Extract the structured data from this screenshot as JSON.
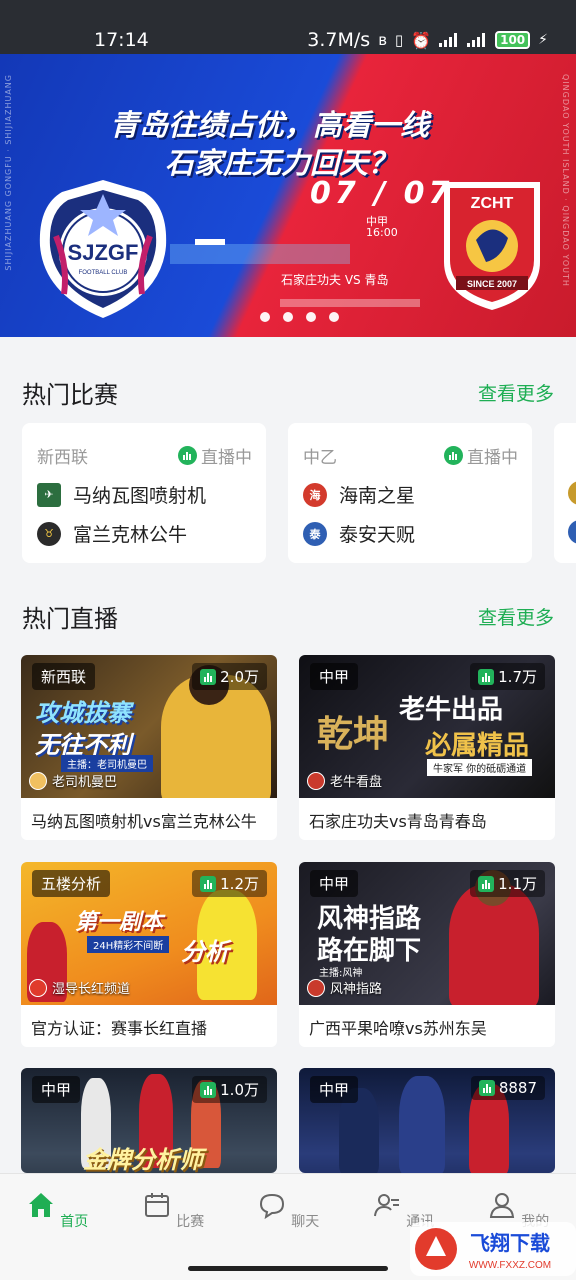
{
  "status_bar": {
    "time": "17:14",
    "speed": "3.7M/s",
    "battery": "100"
  },
  "banner": {
    "headline_line1": "青岛往绩占优，高看一线",
    "headline_line2": "石家庄无力回天？",
    "date": "07 / 07",
    "league": "中甲",
    "kickoff": "16:00",
    "match": "石家庄功夫 VS 青岛",
    "left_crest_text": "SJZGF",
    "left_crest_sub": "FOOTBALL CLUB",
    "right_crest_text": "ZCHT",
    "right_crest_sub": "SINCE 2007",
    "side_left": "SHIJIAZHUANG GONGFU · SHIJIAZHUANG",
    "side_right": "QINGDAO YOUTH ISLAND · QINGDAO YOUTH"
  },
  "hot_matches": {
    "title": "热门比赛",
    "more": "查看更多",
    "items": [
      {
        "league": "新西联",
        "status": "直播中",
        "home": "马纳瓦图喷射机",
        "away": "富兰克林公牛",
        "home_badge_color": "#2c6e3f",
        "away_badge_color": "#2b2b2b"
      },
      {
        "league": "中乙",
        "status": "直播中",
        "home": "海南之星",
        "away": "泰安天贶",
        "home_badge_color": "#d33a2c",
        "away_badge_color": "#2f5fb3"
      }
    ]
  },
  "hot_live": {
    "title": "热门直播",
    "more": "查看更多",
    "items": [
      {
        "league": "新西联",
        "viewers": "2.0万",
        "anchor": "老司机曼巴",
        "caption": "马纳瓦图喷射机vs富兰克林公牛",
        "thumb_text1": "攻城拔寨",
        "thumb_text2": "无往不利",
        "thumb_sub": "主播：老司机曼巴"
      },
      {
        "league": "中甲",
        "viewers": "1.7万",
        "anchor": "老牛看盘",
        "caption": "石家庄功夫vs青岛青春岛",
        "thumb_text1": "老牛出品",
        "thumb_text2": "必属精品",
        "thumb_sub": "牛家军 你的砥砺通道"
      },
      {
        "league": "五楼分析",
        "viewers": "1.2万",
        "anchor": "湿导长红频道",
        "caption": "官方认证：赛事长红直播",
        "thumb_text1": "第一剧本",
        "thumb_text2": "分析",
        "thumb_sub": "24H精彩不间断"
      },
      {
        "league": "中甲",
        "viewers": "1.1万",
        "anchor": "风神指路",
        "caption": "广西平果哈嘹vs苏州东吴",
        "thumb_text1": "风神指路",
        "thumb_text2": "路在脚下",
        "thumb_sub": "主播:风神"
      },
      {
        "league": "中甲",
        "viewers": "1.0万",
        "anchor": "",
        "caption": "",
        "thumb_text1": "金牌分析师",
        "thumb_text2": "",
        "thumb_sub": ""
      },
      {
        "league": "中甲",
        "viewers": "8887",
        "anchor": "",
        "caption": "",
        "thumb_text1": "",
        "thumb_text2": "",
        "thumb_sub": ""
      }
    ]
  },
  "bottom_nav": {
    "items": [
      {
        "label": "首页",
        "active": true
      },
      {
        "label": "比赛",
        "active": false
      },
      {
        "label": "聊天",
        "active": false
      },
      {
        "label": "通讯",
        "active": false
      },
      {
        "label": "我的",
        "active": false
      }
    ]
  },
  "watermark": {
    "text": "飞翔下载",
    "url": "WWW.FXXZ.COM"
  },
  "colors": {
    "accent": "#1fae54",
    "banner_blue": "#1a4bd8",
    "banner_red": "#e8243b"
  }
}
